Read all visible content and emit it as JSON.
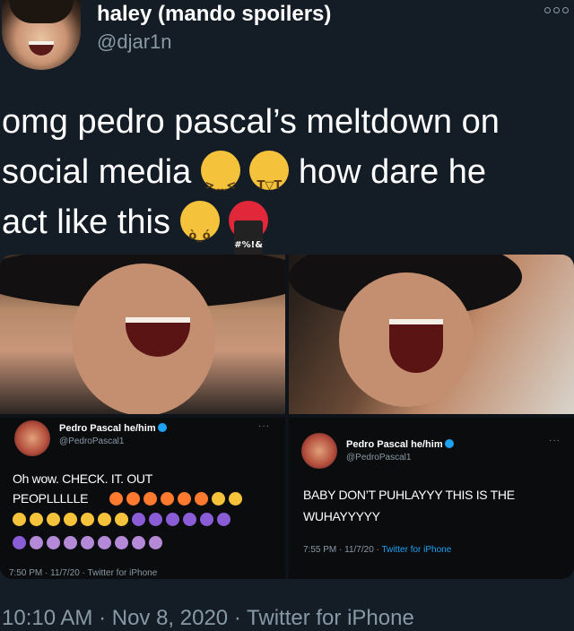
{
  "author": {
    "display_name": "haley (mando spoilers)",
    "handle": "@djar1n"
  },
  "tweet": {
    "line1": "omg pedro pascal’s meltdown on",
    "line2_a": "social media",
    "line2_b": "how dare he",
    "line3": "act like this",
    "emojis": [
      "weary-face",
      "loudly-crying-face",
      "angry-face",
      "face-with-symbols-on-mouth"
    ],
    "cursing_text": "#%!&"
  },
  "media": {
    "left_screenshot": {
      "name": "Pedro Pascal he/him",
      "handle": "@PedroPascal1",
      "more": "···",
      "text_line1": "Oh wow. CHECK. IT. OUT",
      "text_line2": "PEOPLLLLLE",
      "meta": "7:50 PM · 11/7/20 · Twitter for iPhone",
      "emoji_row1": [
        "rainbow",
        "rainbow",
        "rainbow",
        "rainbow",
        "rainbow",
        "rainbow",
        "hugging-face",
        "hugging-face"
      ],
      "emoji_row2": [
        "hugging-face",
        "hugging-face",
        "hugging-face",
        "hugging-face",
        "hugging-face",
        "hugging-face",
        "hugging-face",
        "alien-monster",
        "alien-monster",
        "alien-monster",
        "alien-monster",
        "alien-monster",
        "alien-monster"
      ],
      "emoji_row3": [
        "alien-monster",
        "mage",
        "mage",
        "mage",
        "mage",
        "mage",
        "mage",
        "mage",
        "mage"
      ],
      "colors": {
        "rainbow": "#ff7a2f",
        "hugging-face": "#f5c33b",
        "alien-monster": "#8a5cd6",
        "mage": "#b48ad8"
      }
    },
    "right_screenshot": {
      "name": "Pedro Pascal he/him",
      "handle": "@PedroPascal1",
      "more": "···",
      "text_line1": "BABY DON’T PUHLAYYY THIS IS THE",
      "text_line2": "WUHAYYYYY",
      "meta_prefix": "7:55 PM · 11/7/20 · ",
      "meta_source": "Twitter for iPhone"
    }
  },
  "footer": {
    "timestamp": "10:10 AM · Nov 8, 2020 · Twitter for iPhone"
  },
  "colors": {
    "background": "#141d26",
    "secondary_text": "#8899a6",
    "accent": "#1da1f2"
  }
}
